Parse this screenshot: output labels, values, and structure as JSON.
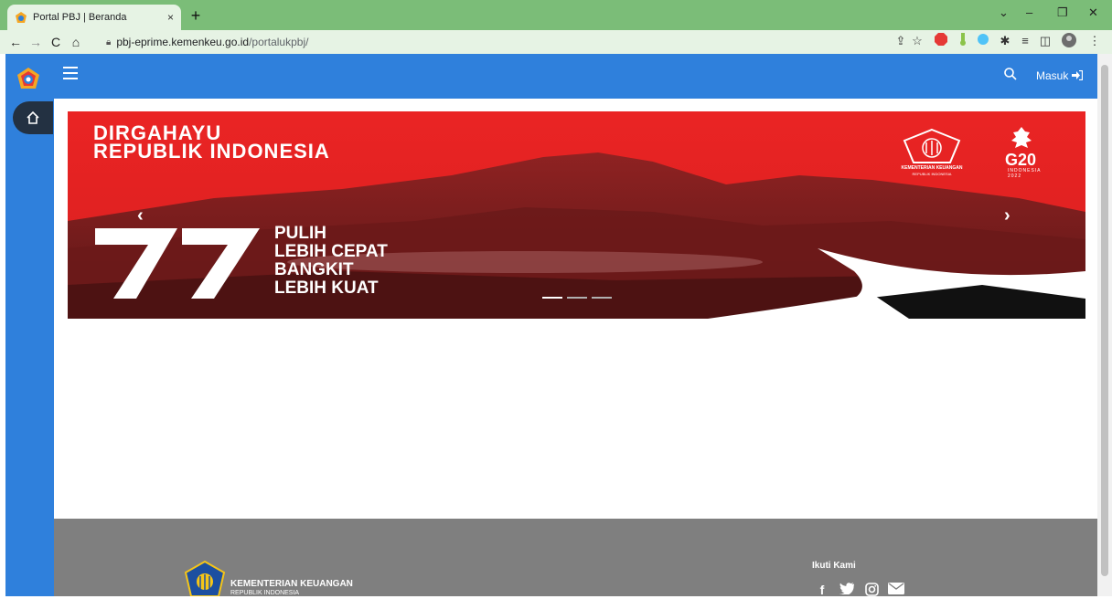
{
  "browser": {
    "tab_title": "Portal PBJ | Beranda",
    "tab_close": "×",
    "new_tab": "+",
    "url_domain": "pbj-eprime.kemenkeu.go.id",
    "url_path": "/portalukpbj/"
  },
  "header": {
    "login_label": "Masuk"
  },
  "banner": {
    "title_line1": "DIRGAHAYU",
    "title_line2": "REPUBLIK INDONESIA",
    "number": "77",
    "slogan_line1": "PULIH",
    "slogan_line2": "LEBIH CEPAT",
    "slogan_line3": "BANGKIT",
    "slogan_line4": "LEBIH KUAT",
    "ministry_line1": "KEMENTERIAN KEUANGAN",
    "ministry_line2": "REPUBLIK INDONESIA",
    "g20": "G20",
    "g20_sub": "INDONESIA",
    "g20_year": "2022",
    "active_slide": 1,
    "slide_count": 3
  },
  "footer": {
    "org_name": "KEMENTERIAN KEUANGAN",
    "org_sub": "REPUBLIK INDONESIA",
    "follow_label": "Ikuti Kami",
    "social": [
      "facebook",
      "twitter",
      "instagram",
      "email"
    ]
  },
  "colors": {
    "primary": "#2f80dc",
    "banner_red": "#ea2424",
    "footer_gray": "#7f7f7f",
    "tab_green": "#7bbd78"
  }
}
